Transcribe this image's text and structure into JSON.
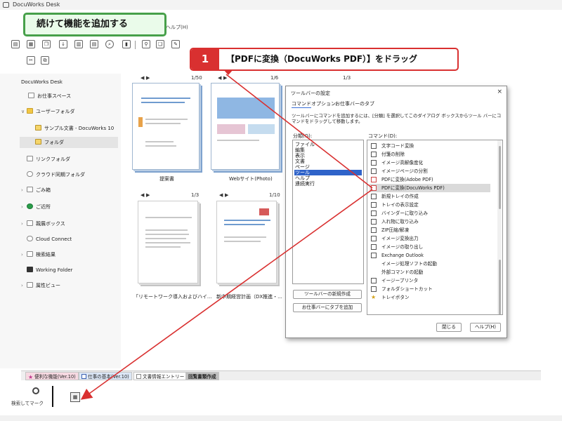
{
  "app": {
    "title": "DocuWorks Desk",
    "menu_tail": "ヘルプ(H)"
  },
  "callouts": {
    "green": "続けて機能を追加する",
    "red_number": "1",
    "red_text": "【PDFに変換（DocuWorks PDF）】をドラッグ"
  },
  "sidebar": {
    "items": [
      {
        "label": "DocuWorks Desk"
      },
      {
        "label": "お仕事スペース"
      },
      {
        "label": "ユーザーフォルダ"
      },
      {
        "label": "サンプル文書 - DocuWorks 10"
      },
      {
        "label": "フォルダ"
      },
      {
        "label": "リンクフォルダ"
      },
      {
        "label": "クラウド同期フォルダ"
      },
      {
        "label": "ごみ箱"
      },
      {
        "label": "ご近所"
      },
      {
        "label": "親展ボックス"
      },
      {
        "label": "Cloud Connect"
      },
      {
        "label": "検索結果"
      },
      {
        "label": "Working Folder"
      },
      {
        "label": "属性ビュー"
      }
    ]
  },
  "documents": [
    {
      "pager": "1/50",
      "label": "提案書"
    },
    {
      "pager": "1/6",
      "label": "Webサイト(Photo)"
    },
    {
      "pager": "1/3",
      "label": ""
    },
    {
      "pager": "1/3",
      "label": "「リモートワーク導入およびハイ..."
    },
    {
      "pager": "1/10",
      "label": "新中期経営計画（DX推進・..."
    }
  ],
  "dialog": {
    "title": "ツールバーの設定",
    "close": "×",
    "tabs": [
      "コマンド",
      "オプション",
      "お仕事バーのタブ"
    ],
    "description": "ツールバーにコマンドを追加するには、[分類] を選択してこのダイアログ ボックスからツール バーにコマンドをドラッグして移動します。",
    "category_label": "分類(G):",
    "command_label": "コマンド(D):",
    "categories": [
      "ファイル",
      "編集",
      "表示",
      "文書",
      "ページ",
      "ツール",
      "ヘルプ",
      "連続実行"
    ],
    "selected_category": "ツール",
    "commands": [
      {
        "label": "文字コード変換",
        "icon": "doc-icon"
      },
      {
        "label": "付箋の削除",
        "icon": "note-icon"
      },
      {
        "label": "イメージ高解像度化",
        "icon": "image-icon"
      },
      {
        "label": "イメージページの分割",
        "icon": "split-icon"
      },
      {
        "label": "PDFに変換(Adobe PDF)",
        "icon": "pdf-icon"
      },
      {
        "label": "PDFに変換(DocuWorks PDF)",
        "icon": "pdf-icon"
      },
      {
        "label": "新規トレイの作成",
        "icon": "tray-icon"
      },
      {
        "label": "トレイの表示設定",
        "icon": "tray-icon"
      },
      {
        "label": "バインダーに取り込み",
        "icon": "binder-icon"
      },
      {
        "label": "入れ物に取り込み",
        "icon": "box-icon"
      },
      {
        "label": "ZIP圧縮/解凍",
        "icon": "zip-icon"
      },
      {
        "label": "イメージ変換出力",
        "icon": "image-icon"
      },
      {
        "label": "イメージの取り出し",
        "icon": "image-icon"
      },
      {
        "label": "Exchange Outlook",
        "icon": "mail-icon"
      },
      {
        "label": "イメージ処理ソフトの起動",
        "icon": "blank"
      },
      {
        "label": "外部コマンドの起動",
        "icon": "blank"
      },
      {
        "label": "イージープリンタ",
        "icon": "printer-icon"
      },
      {
        "label": "フォルダショートカット",
        "icon": "folder-icon"
      },
      {
        "label": "トレイボタン",
        "icon": "star-icon"
      }
    ],
    "selected_command": "PDFに変換(DocuWorks PDF)",
    "new_toolbar_button": "ツールバーの新規作成",
    "add_tab_button": "お仕事バーにタブを追加",
    "close_button": "閉じる",
    "help_button": "ヘルプ(H)"
  },
  "bottom_tabs": [
    {
      "label": "便利な機能(Ver.10)",
      "style": "pink"
    },
    {
      "label": "仕事の基本(Ver.10)",
      "style": "blue"
    },
    {
      "label": "文書情報エントリー",
      "style": "plain"
    },
    {
      "label": "回覧書類作成",
      "style": "active"
    }
  ],
  "bottom_panel": {
    "search_label": "検索してマーク"
  },
  "colors": {
    "callout_red": "#d93030",
    "callout_green_border": "#47a04a",
    "selection_blue": "#2f63c9"
  }
}
